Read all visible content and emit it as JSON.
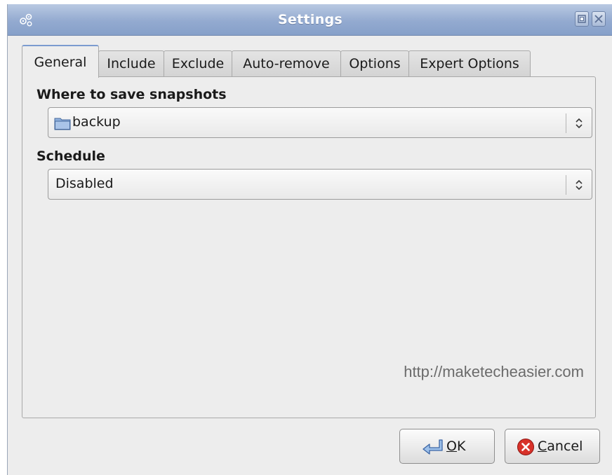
{
  "window": {
    "title": "Settings",
    "icon": "settings-app-icon",
    "controls": [
      "maximize-icon",
      "close-icon"
    ]
  },
  "tabs": [
    {
      "label": "General",
      "active": true
    },
    {
      "label": "Include",
      "active": false
    },
    {
      "label": "Exclude",
      "active": false
    },
    {
      "label": "Auto-remove",
      "active": false
    },
    {
      "label": "Options",
      "active": false
    },
    {
      "label": "Expert Options",
      "active": false
    }
  ],
  "general": {
    "save_label": "Where to save snapshots",
    "save_value": "backup",
    "save_icon": "folder-icon",
    "schedule_label": "Schedule",
    "schedule_value": "Disabled"
  },
  "watermark": "http://maketecheasier.com",
  "buttons": {
    "ok": {
      "mnemonic": "O",
      "rest": "K",
      "icon": "ok-arrow-icon"
    },
    "cancel": {
      "mnemonic": "C",
      "rest": "ancel",
      "icon": "cancel-icon"
    }
  },
  "colors": {
    "titlebar": "#93aad0",
    "accent": "#7b9bd0",
    "cancel_red": "#d8322a"
  }
}
